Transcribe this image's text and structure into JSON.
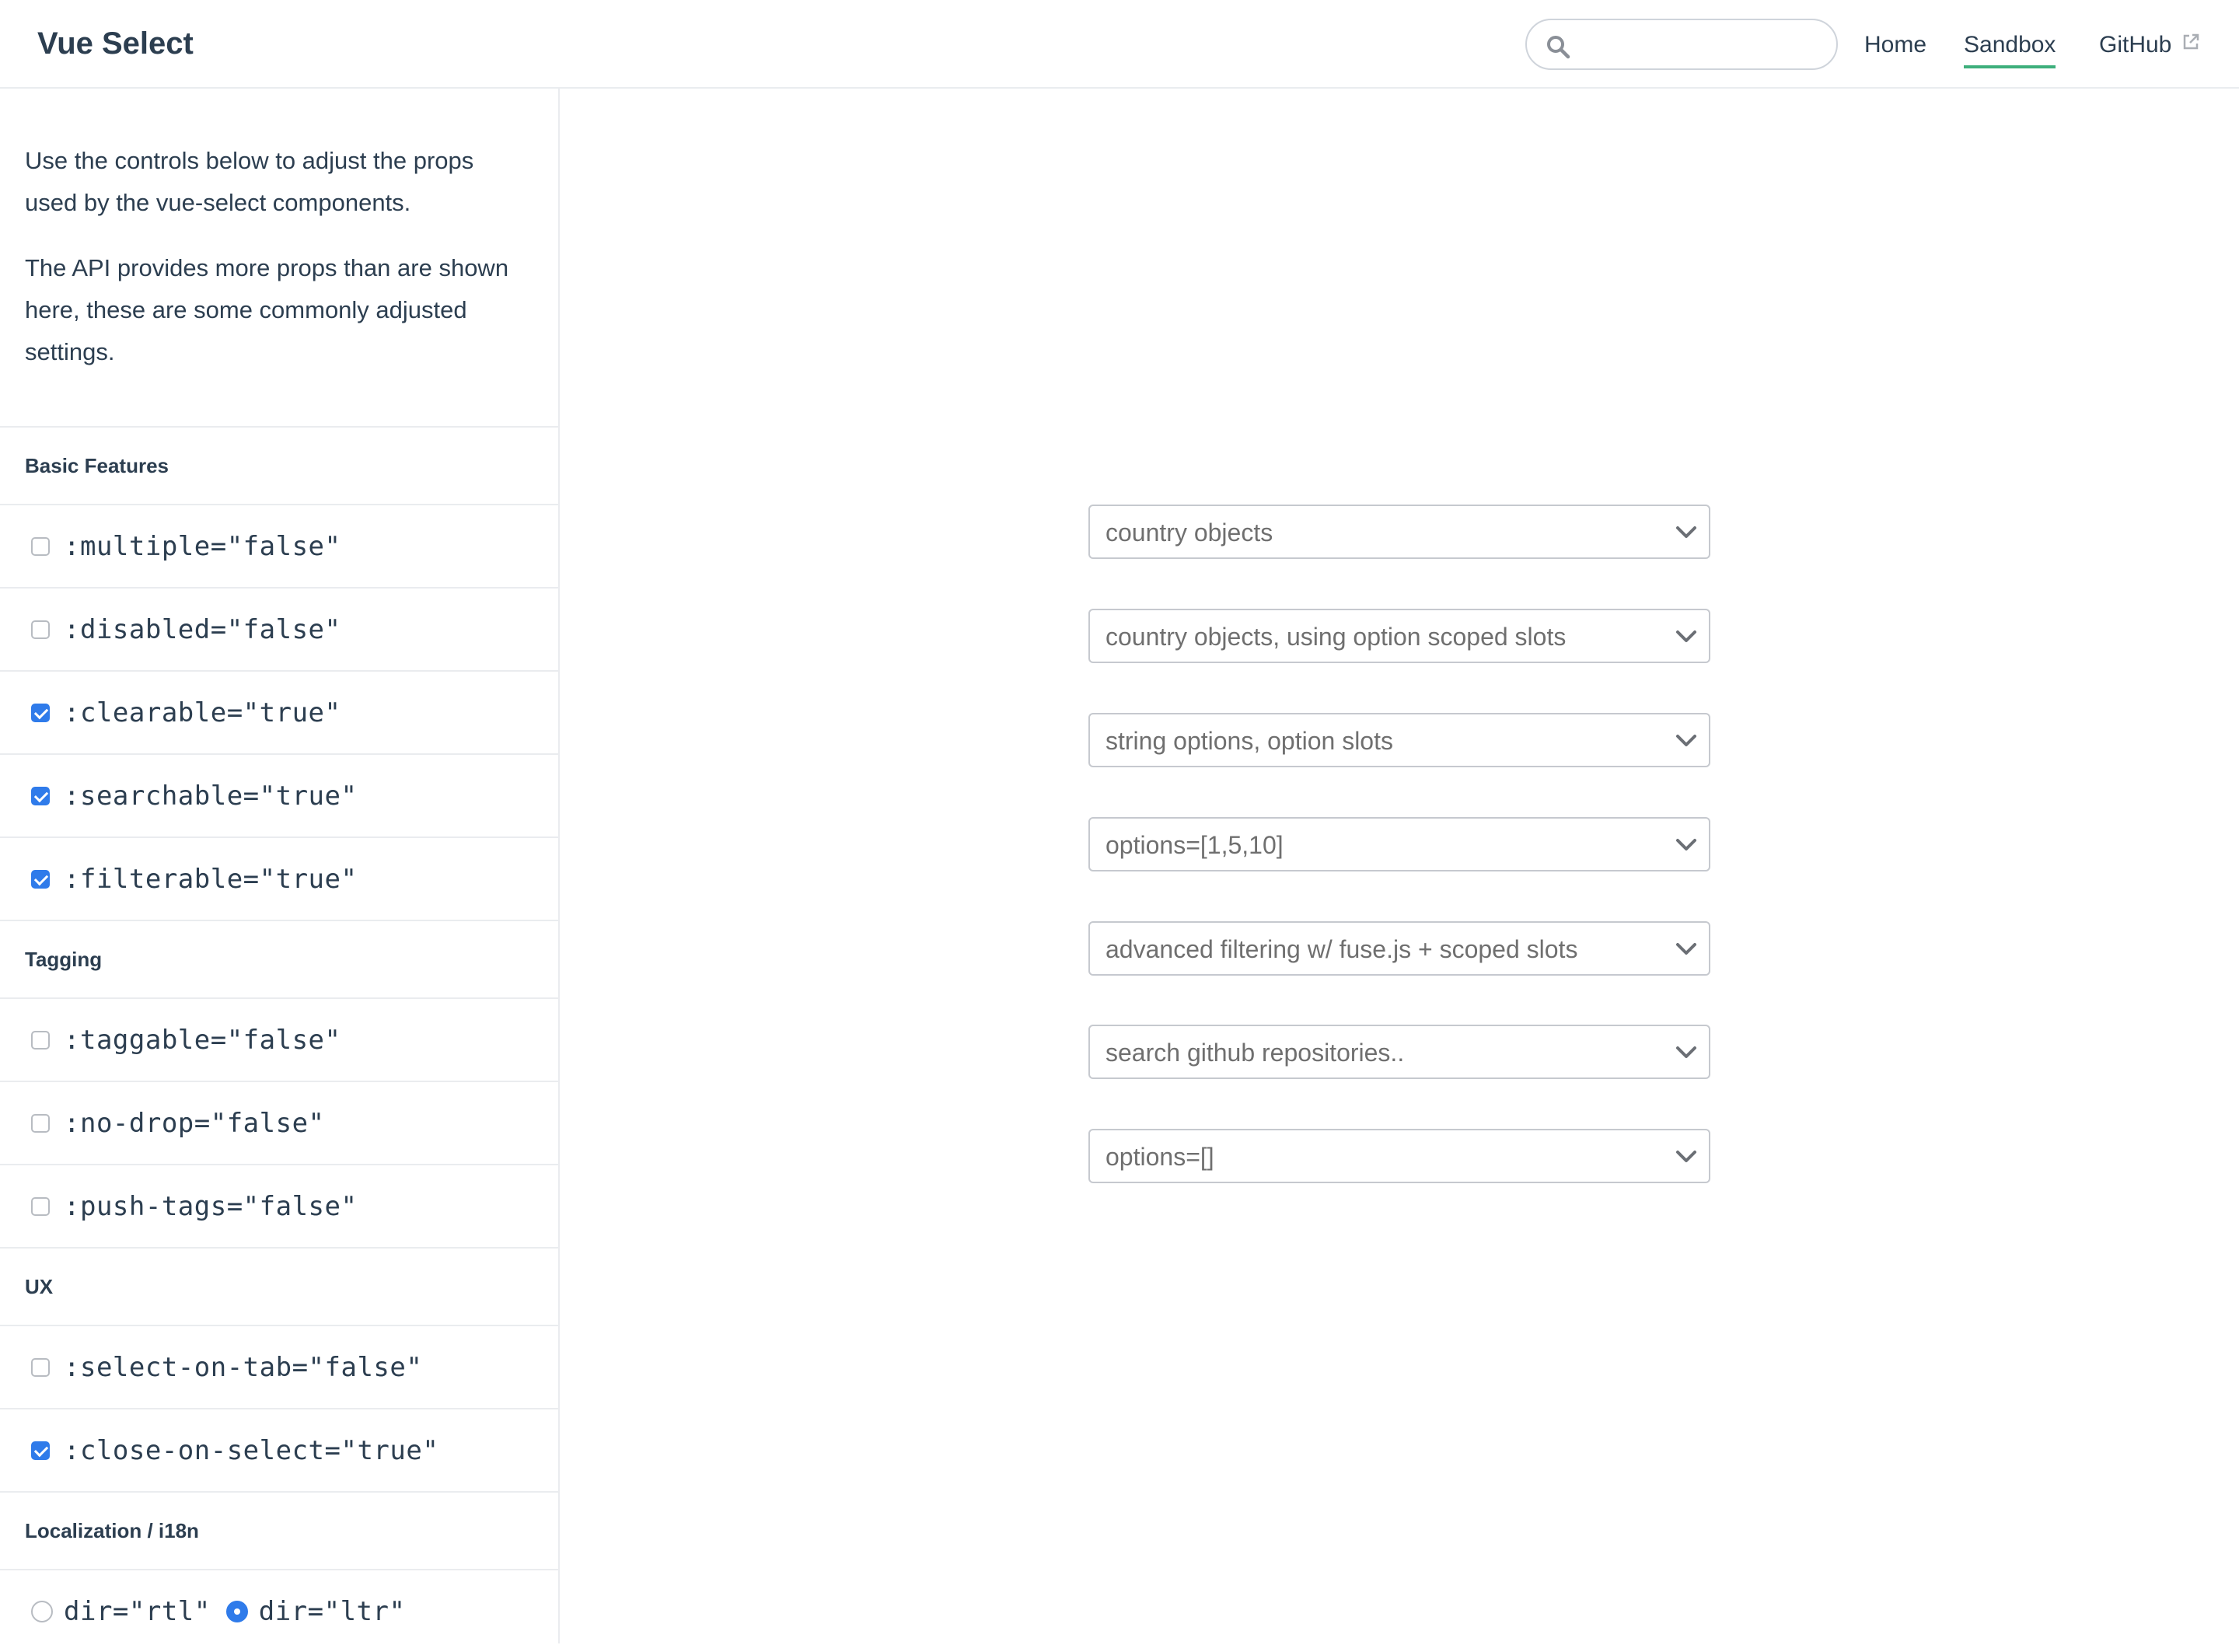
{
  "header": {
    "site_name": "Vue Select",
    "search": {
      "placeholder": "",
      "value": ""
    },
    "nav": {
      "home": "Home",
      "sandbox": "Sandbox",
      "github": "GitHub"
    },
    "active_nav": "Sandbox",
    "accent_color": "#3eaf7c"
  },
  "sidebar": {
    "intro": [
      "Use the controls below to adjust the props used by the vue-select components.",
      "The API provides more props than are shown here, these are some commonly adjusted settings."
    ],
    "sections": {
      "basic": {
        "title": "Basic Features",
        "options": [
          {
            "label": ":multiple=\"false\"",
            "checked": false
          },
          {
            "label": ":disabled=\"false\"",
            "checked": false
          },
          {
            "label": ":clearable=\"true\"",
            "checked": true
          },
          {
            "label": ":searchable=\"true\"",
            "checked": true
          },
          {
            "label": ":filterable=\"true\"",
            "checked": true
          }
        ]
      },
      "tagging": {
        "title": "Tagging",
        "options": [
          {
            "label": ":taggable=\"false\"",
            "checked": false
          },
          {
            "label": ":no-drop=\"false\"",
            "checked": false
          },
          {
            "label": ":push-tags=\"false\"",
            "checked": false
          }
        ]
      },
      "ux": {
        "title": "UX",
        "options": [
          {
            "label": ":select-on-tab=\"false\"",
            "checked": false
          },
          {
            "label": ":close-on-select=\"true\"",
            "checked": true
          }
        ]
      },
      "i18n": {
        "title": "Localization / i18n",
        "radios": [
          {
            "label": "dir=\"rtl\"",
            "selected": false
          },
          {
            "label": "dir=\"ltr\"",
            "selected": true
          }
        ]
      }
    },
    "checkbox_color": "#2f7bea"
  },
  "main": {
    "selects": [
      {
        "placeholder": "country objects"
      },
      {
        "placeholder": "country objects, using option scoped slots"
      },
      {
        "placeholder": "string options, option slots"
      },
      {
        "placeholder": "options=[1,5,10]"
      },
      {
        "placeholder": "advanced filtering w/ fuse.js + scoped slots"
      },
      {
        "placeholder": "search github repositories.."
      },
      {
        "placeholder": "options=[]"
      }
    ]
  }
}
